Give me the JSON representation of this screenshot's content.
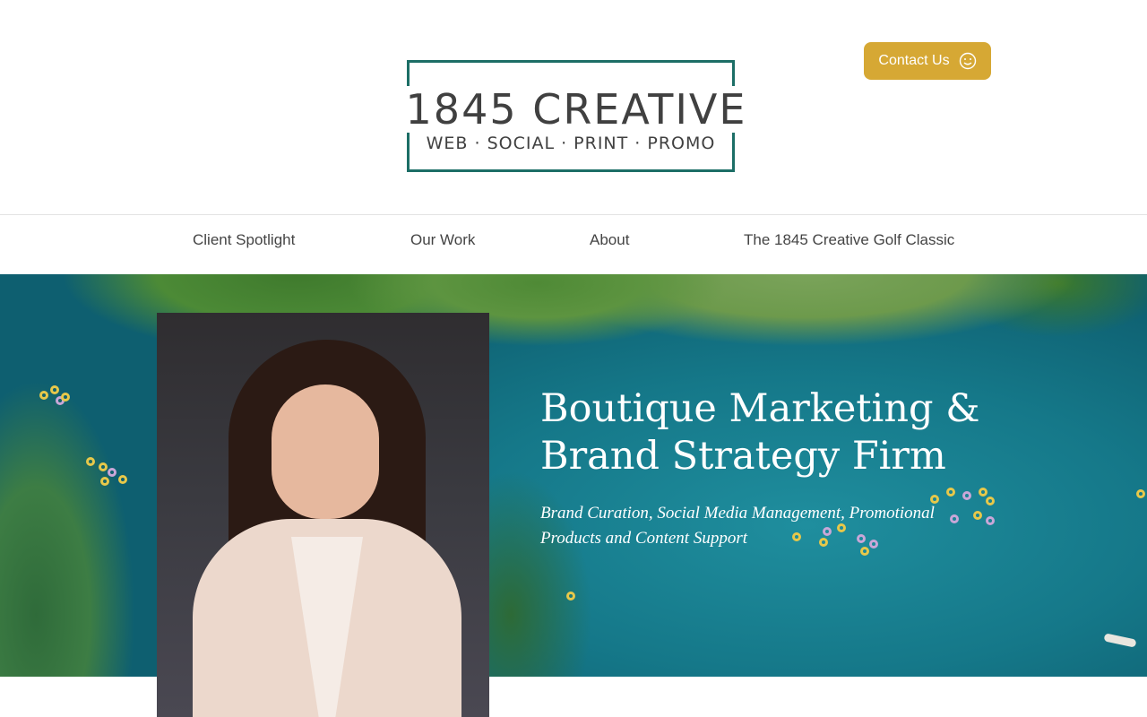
{
  "header": {
    "logo": {
      "brand": "1845 CREATIVE",
      "tagline": "WEB · SOCIAL · PRINT · PROMO"
    },
    "contact_button": {
      "label": "Contact Us",
      "icon": "smiley-icon"
    }
  },
  "nav": {
    "items": [
      {
        "label": "Client Spotlight"
      },
      {
        "label": "Our Work"
      },
      {
        "label": "About"
      },
      {
        "label": "The 1845 Creative Golf Classic"
      }
    ]
  },
  "hero": {
    "title": "Boutique Marketing & Brand Strategy Firm",
    "subtitle": "Brand Curation, Social Media Management,  Promotional Products and Content Support"
  },
  "colors": {
    "accent": "#d6a834",
    "logo_border": "#1c6e66",
    "text_dark": "#404040",
    "water": "#157889"
  }
}
